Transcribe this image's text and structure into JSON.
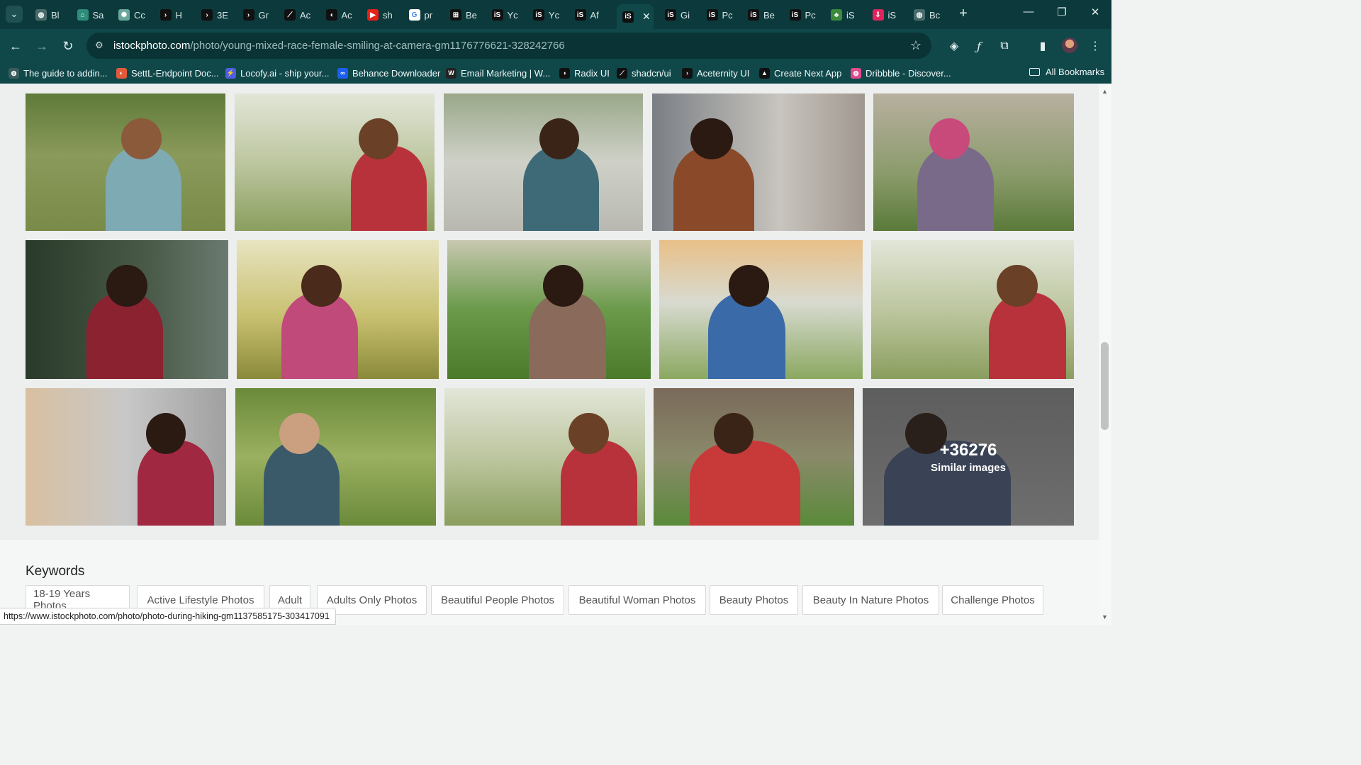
{
  "tabs": [
    {
      "label": "Bl",
      "icon": "globe-icon",
      "color": "#4a6b6c"
    },
    {
      "label": "Sa",
      "icon": "home-icon",
      "color": "#2e8c7a"
    },
    {
      "label": "Cc",
      "icon": "openai-icon",
      "color": "#6aa79b"
    },
    {
      "label": "H",
      "icon": "prompt-icon",
      "color": "#111111"
    },
    {
      "label": "3E",
      "icon": "prompt-icon",
      "color": "#111111"
    },
    {
      "label": "Gr",
      "icon": "prompt-icon",
      "color": "#111111"
    },
    {
      "label": "Ac",
      "icon": "slash-icon",
      "color": "#111111"
    },
    {
      "label": "Ac",
      "icon": "radix-icon",
      "color": "#111111"
    },
    {
      "label": "sh",
      "icon": "youtube-icon",
      "color": "#e62117"
    },
    {
      "label": "pr",
      "icon": "google-icon",
      "color": "#ffffff"
    },
    {
      "label": "Be",
      "icon": "gift-icon",
      "color": "#111111"
    },
    {
      "label": "Yc",
      "icon": "istock-icon",
      "color": "#111111"
    },
    {
      "label": "Yc",
      "icon": "istock-icon",
      "color": "#111111"
    },
    {
      "label": "Af",
      "icon": "istock-icon",
      "color": "#111111"
    },
    {
      "label": "",
      "icon": "istock-icon",
      "color": "#111111",
      "active": true
    },
    {
      "label": "Gi",
      "icon": "istock-icon",
      "color": "#111111"
    },
    {
      "label": "Pc",
      "icon": "istock-icon",
      "color": "#111111"
    },
    {
      "label": "Be",
      "icon": "istock-icon",
      "color": "#111111"
    },
    {
      "label": "Pc",
      "icon": "istock-icon",
      "color": "#111111"
    },
    {
      "label": "iS",
      "icon": "plant-icon",
      "color": "#3c8a3c"
    },
    {
      "label": "iS",
      "icon": "download-icon",
      "color": "#e0245e"
    },
    {
      "label": "Bc",
      "icon": "globe-icon",
      "color": "#4a6b6c"
    }
  ],
  "toolbar": {
    "url_host": "istockphoto.com",
    "url_path": "/photo/young-mixed-race-female-smiling-at-camera-gm1176776621-328242766"
  },
  "bookmarks": [
    {
      "label": "The guide to addin...",
      "icon": "globe-icon",
      "color": "#3a5c5d"
    },
    {
      "label": "SettL-Endpoint Doc...",
      "icon": "settl-icon",
      "color": "#e05a3a"
    },
    {
      "label": "Locofy.ai - ship your...",
      "icon": "bolt-icon",
      "color": "#4c5fe0"
    },
    {
      "label": "Behance Downloader",
      "icon": "behance-icon",
      "color": "#1c5ff0"
    },
    {
      "label": "Email Marketing | W...",
      "icon": "wix-icon",
      "color": "#222222"
    },
    {
      "label": "Radix UI",
      "icon": "radix-icon",
      "color": "#111111"
    },
    {
      "label": "shadcn/ui",
      "icon": "slash-icon",
      "color": "#111111"
    },
    {
      "label": "Aceternity UI",
      "icon": "prompt-icon",
      "color": "#111111"
    },
    {
      "label": "Create Next App",
      "icon": "triangle-icon",
      "color": "#111111"
    },
    {
      "label": "Dribbble - Discover...",
      "icon": "dribbble-icon",
      "color": "#e04a8a"
    }
  ],
  "all_bookmarks_label": "All Bookmarks",
  "similar": {
    "count": "+36276",
    "label": "Similar images"
  },
  "keywords": {
    "title": "Keywords",
    "chips": [
      "18-19 Years Photos",
      "Active Lifestyle Photos",
      "Adult",
      "Adults Only Photos",
      "Beautiful People Photos",
      "Beautiful Woman Photos",
      "Beauty Photos",
      "Beauty In Nature Photos",
      "Challenge Photos"
    ]
  },
  "status_url": "https://www.istockphoto.com/photo/photo-during-hiking-gm1137585175-303417091"
}
